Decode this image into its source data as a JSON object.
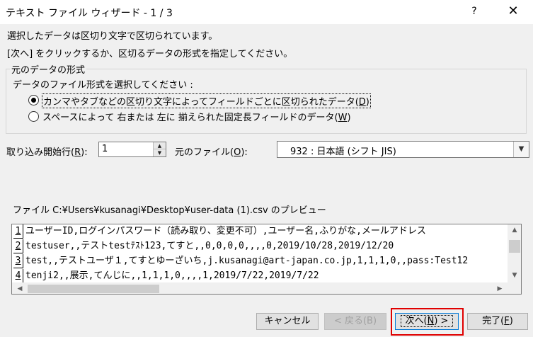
{
  "window": {
    "title": "テキスト ファイル ウィザード - 1 / 3",
    "help": "?",
    "close": "✕"
  },
  "description": {
    "line1": "選択したデータは区切り文字で区切られています。",
    "line2": "[次へ] をクリックするか、区切るデータの形式を指定してください。"
  },
  "group": {
    "title": "元のデータの形式",
    "prompt": "データのファイル形式を選択してください :",
    "option1_label": "カンマやタブなどの区切り文字によってフィールドごとに区切られたデータ(",
    "option1_key": "D",
    "option1_close": ")",
    "option2_label": "スペースによって 右または 左に 揃えられた固定長フィールドのデータ(",
    "option2_key": "W",
    "option2_close": ")",
    "selected": 1
  },
  "start_row": {
    "label": "取り込み開始行(",
    "key": "R",
    "close": "):",
    "value": "1"
  },
  "origin": {
    "label": "元のファイル(",
    "key": "O",
    "close": "):",
    "value": "932 : 日本語 (シフト JIS)"
  },
  "preview": {
    "label": "ファイル C:¥Users¥kusanagi¥Desktop¥user-data (1).csv のプレビュー",
    "rows": [
      {
        "num": "1",
        "text": "ユーザーID,ログインパスワード（読み取り、変更不可）,ユーザー名,ふりがな,メールアドレス"
      },
      {
        "num": "2",
        "text": "testuser,,テストtestﾃｽﾄ123,てすと,,0,0,0,0,,,,0,2019/10/28,2019/12/20"
      },
      {
        "num": "3",
        "text": "test,,テストユーザ１,てすとゆーざいち,j.kusanagi@art-japan.co.jp,1,1,1,0,,pass:Test12"
      },
      {
        "num": "4",
        "text": "tenji2,,展示,てんじに,,1,1,1,0,,,,1,2019/7/22,2019/7/22"
      }
    ]
  },
  "buttons": {
    "cancel": "キャンセル",
    "back": "< 戻る(B)",
    "next_prefix": "次へ(",
    "next_key": "N",
    "next_suffix": ") >",
    "finish_prefix": "完了(",
    "finish_key": "F",
    "finish_suffix": ")"
  },
  "icons": {
    "spin_up": "spin-up-arrow-icon",
    "spin_down": "spin-down-arrow-icon",
    "dropdown": "chevron-down-icon"
  },
  "colors": {
    "highlight": "#e00000",
    "focus": "#0078d7"
  }
}
